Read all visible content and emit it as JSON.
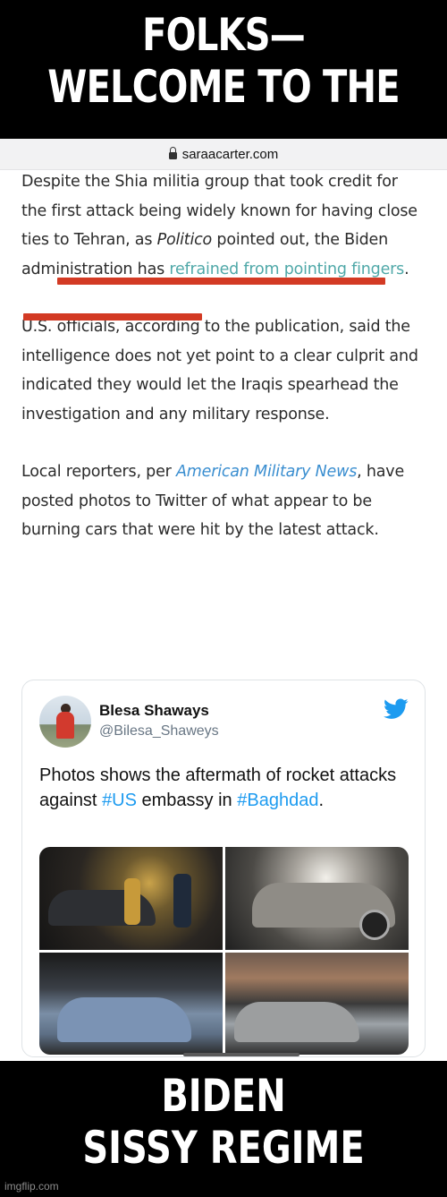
{
  "meme": {
    "top_line_1": "FOLKS—",
    "top_line_2": "WELCOME TO THE",
    "bottom_line_1": "BIDEN",
    "bottom_line_2": "SISSY REGIME",
    "watermark": "imgflip.com"
  },
  "browser": {
    "url": "saraacarter.com",
    "lock_icon": "lock-icon"
  },
  "article": {
    "p1_a": "Despite the Shia militia group that took credit for the first attack being widely known for having close ties to Tehran, as ",
    "p1_em": "Politico",
    "p1_b": " pointed out, the Biden administration has ",
    "p1_link": "refrained from pointing fingers",
    "p1_end": ".",
    "p2": "U.S. officials, according to the publication, said the intelligence does not yet point to a clear culprit and indicated they would let the Iraqis spearhead the investigation and any military response.",
    "p3_a": "Local reporters, per ",
    "p3_link": "American Military News",
    "p3_b": ", have posted photos to Twitter of what appear to be burning cars that were hit by the latest attack.",
    "highlight_color": "#d33a24",
    "link_color": "#4fa8a8"
  },
  "tweet": {
    "name": "Blesa Shaways",
    "handle": "@Bilesa_Shaweys",
    "text_a": "Photos shows the aftermath of rocket attacks against ",
    "tag1": "#US",
    "text_b": " embassy in ",
    "tag2": "#Baghdad",
    "text_end": ".",
    "icon": "twitter-bird-icon",
    "accent": "#1d9bf0"
  }
}
